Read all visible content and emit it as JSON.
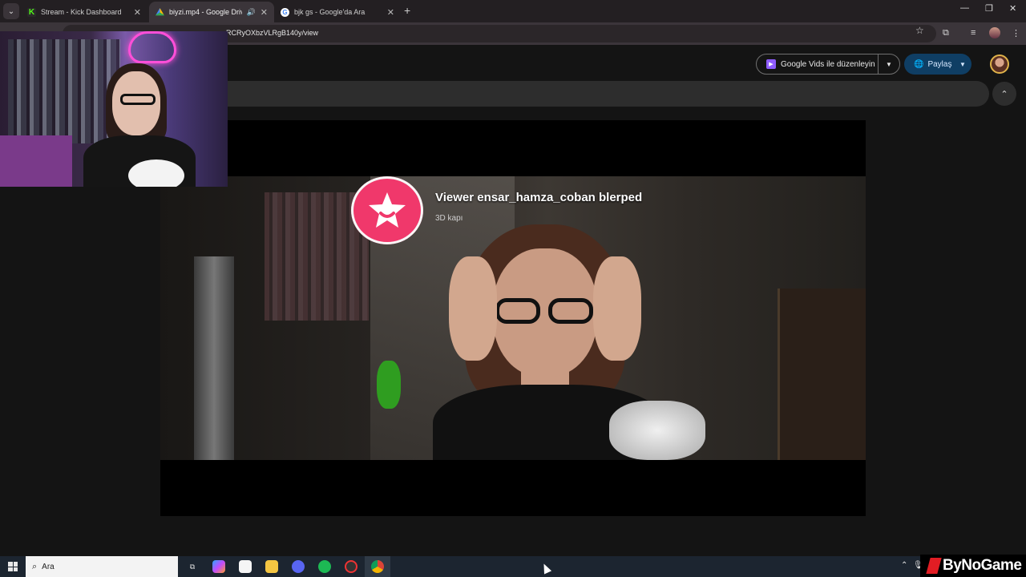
{
  "browser": {
    "tabs": [
      {
        "title": "Stream - Kick Dashboard",
        "icon": "kick-icon",
        "active": false
      },
      {
        "title": "biyzi.mp4 - Google Drive",
        "icon": "google-drive-icon",
        "active": true
      },
      {
        "title": "bjk gs - Google'da Ara",
        "icon": "google-icon",
        "active": false
      }
    ],
    "new_tab": "+",
    "url": "RCRyOXbzVLRgB140y/view"
  },
  "drive": {
    "vids_button": "Google Vids ile düzenleyin",
    "share_button": "Paylaş"
  },
  "video": {
    "alert_title": "Viewer ensar_hamza_coban blerped",
    "alert_subtitle": "3D kapı"
  },
  "taskbar": {
    "search_placeholder": "Ara",
    "brand": "ByNoGame"
  },
  "colors": {
    "accent_pink": "#f0386b",
    "share_blue": "#0f3e64",
    "kick_green": "#53fc18"
  }
}
